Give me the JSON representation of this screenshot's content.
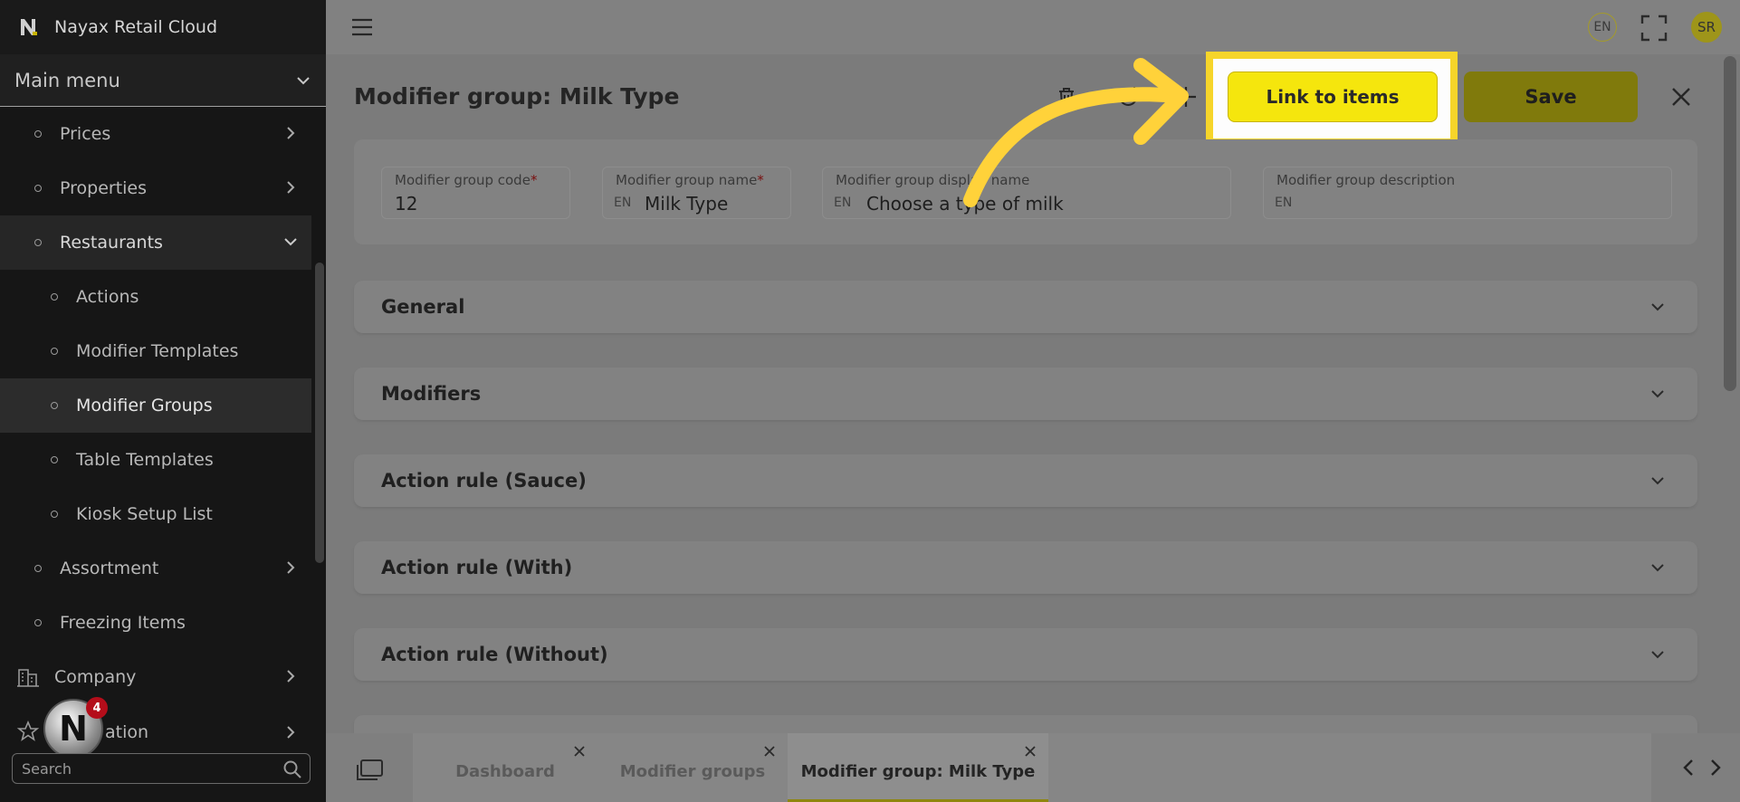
{
  "app": {
    "title": "Nayax Retail Cloud"
  },
  "sidebar": {
    "main_menu": "Main menu",
    "items": [
      {
        "label": "Prices"
      },
      {
        "label": "Properties"
      },
      {
        "label": "Restaurants"
      },
      {
        "label": "Actions"
      },
      {
        "label": "Modifier Templates"
      },
      {
        "label": "Modifier Groups"
      },
      {
        "label": "Table Templates"
      },
      {
        "label": "Kiosk Setup List"
      },
      {
        "label": "Assortment"
      },
      {
        "label": "Freezing Items"
      },
      {
        "label": "Company"
      },
      {
        "label": "ation"
      }
    ],
    "notification_count": "4",
    "search_placeholder": "Search"
  },
  "topbar": {
    "language": "EN",
    "user_initials": "SR"
  },
  "page": {
    "title": "Modifier group: Milk Type",
    "link_button": "Link to items",
    "save_button": "Save"
  },
  "form": {
    "code": {
      "label": "Modifier group code",
      "required": "*",
      "value": "12"
    },
    "name": {
      "label": "Modifier group name",
      "required": "*",
      "lang": "EN",
      "value": "Milk Type"
    },
    "display_name": {
      "label": "Modifier group display name",
      "lang": "EN",
      "value": "Choose a type of milk"
    },
    "description": {
      "label": "Modifier group description",
      "lang": "EN",
      "value": ""
    }
  },
  "sections": [
    {
      "title": "General"
    },
    {
      "title": "Modifiers"
    },
    {
      "title": "Action rule (Sauce)"
    },
    {
      "title": "Action rule (With)"
    },
    {
      "title": "Action rule (Without)"
    }
  ],
  "tabs": [
    {
      "label": "Dashboard"
    },
    {
      "label": "Modifier groups"
    },
    {
      "label": "Modifier group: Milk Type"
    }
  ],
  "colors": {
    "accent": "#f5e60d",
    "highlight": "#f6d52a",
    "save": "#807a0c"
  }
}
